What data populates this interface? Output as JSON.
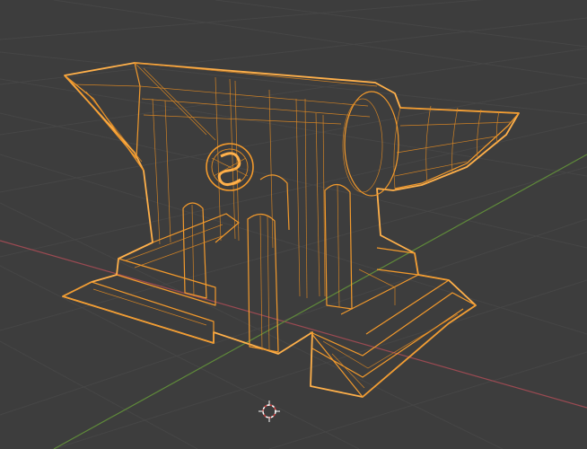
{
  "viewport": {
    "mode": "wireframe",
    "selected_object": "anvil",
    "colors": {
      "background": "#3d3d3d",
      "grid": "#464646",
      "x_axis": "#9b4a52",
      "y_axis": "#5f8a3a",
      "wireframe_selected": "#f39a2c"
    }
  },
  "cursor_3d": {
    "icon": "3d-cursor-icon"
  }
}
